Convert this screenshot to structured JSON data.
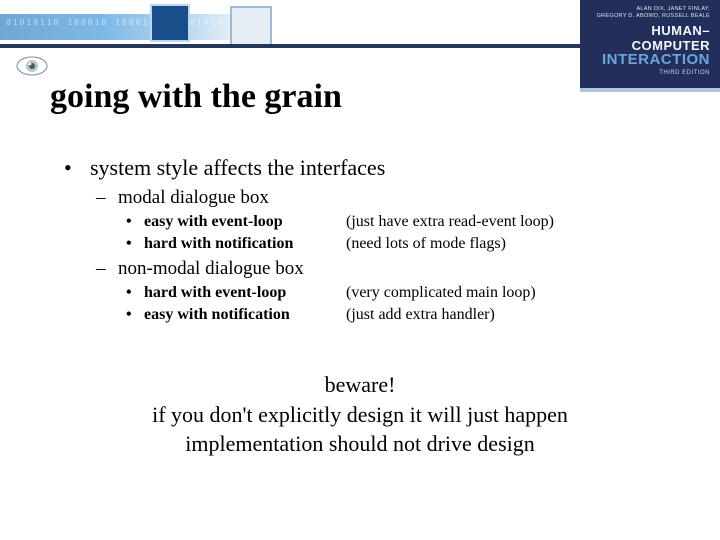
{
  "header": {
    "book_authors_line1": "ALAN DIX, JANET FINLAY,",
    "book_authors_line2": "GREGORY D. ABOWD, RUSSELL BEALE",
    "book_title_line1": "HUMAN–COMPUTER",
    "book_title_line2": "INTERACTION",
    "book_edition": "THIRD EDITION"
  },
  "title": "going with the grain",
  "bullet_main": "system style affects the interfaces",
  "sub1": {
    "heading": "modal dialogue box",
    "row1_left": "easy with event-loop",
    "row1_right": "(just have extra read-event loop)",
    "row2_left": "hard with notification",
    "row2_right": "(need lots of mode flags)"
  },
  "sub2": {
    "heading": "non-modal dialogue box",
    "row1_left": "hard with event-loop",
    "row1_right": "(very complicated main loop)",
    "row2_left": "easy with notification",
    "row2_right": "(just add extra handler)"
  },
  "beware": {
    "line1": "beware!",
    "line2": "if you don't explicitly design it will just happen",
    "line3": "implementation should not drive design"
  }
}
